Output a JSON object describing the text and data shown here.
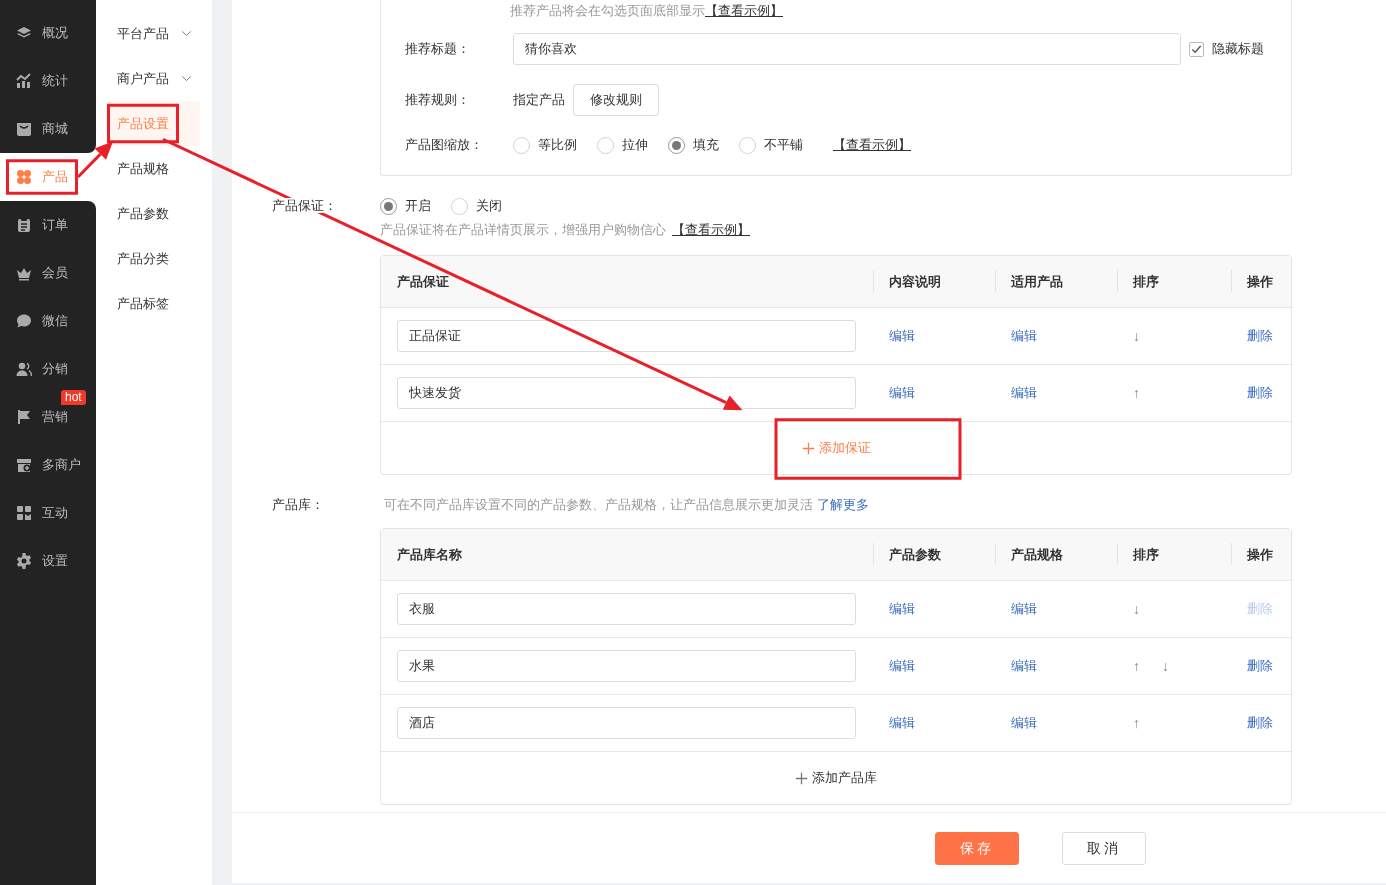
{
  "sidebar": {
    "items": [
      {
        "label": "概况",
        "selected": false,
        "highlighted": false
      },
      {
        "label": "统计",
        "selected": false,
        "highlighted": false
      },
      {
        "label": "商城",
        "selected": false,
        "highlighted": false
      },
      {
        "label": "产品",
        "selected": true,
        "highlighted": true
      },
      {
        "label": "订单",
        "selected": false,
        "highlighted": false
      },
      {
        "label": "会员",
        "selected": false,
        "highlighted": false
      },
      {
        "label": "微信",
        "selected": false,
        "highlighted": false
      },
      {
        "label": "分销",
        "selected": false,
        "highlighted": false
      },
      {
        "label": "营销",
        "selected": false,
        "highlighted": false,
        "badge": "hot"
      },
      {
        "label": "多商户",
        "selected": false,
        "highlighted": false
      },
      {
        "label": "互动",
        "selected": false,
        "highlighted": false
      },
      {
        "label": "设置",
        "selected": false,
        "highlighted": false
      }
    ]
  },
  "submenu": {
    "items": [
      {
        "label": "平台产品",
        "expandable": true,
        "selected": false,
        "highlighted": false
      },
      {
        "label": "商户产品",
        "expandable": true,
        "selected": false,
        "highlighted": false
      },
      {
        "label": "产品设置",
        "expandable": false,
        "selected": true,
        "highlighted": true
      },
      {
        "label": "产品规格",
        "expandable": false,
        "selected": false,
        "highlighted": false
      },
      {
        "label": "产品参数",
        "expandable": false,
        "selected": false,
        "highlighted": false
      },
      {
        "label": "产品分类",
        "expandable": false,
        "selected": false,
        "highlighted": false
      },
      {
        "label": "产品标签",
        "expandable": false,
        "selected": false,
        "highlighted": false
      }
    ]
  },
  "recommend": {
    "hint": "推荐产品将会在勾选页面底部显示",
    "hint_link": "【查看示例】",
    "title_label": "推荐标题：",
    "title_value": "猜你喜欢",
    "hide_title": {
      "label": "隐藏标题",
      "checked": true
    },
    "rule_label": "推荐规则：",
    "rule_value": "指定产品",
    "rule_button": "修改规则",
    "scale_label": "产品图缩放：",
    "scale_options": [
      {
        "label": "等比例",
        "selected": false
      },
      {
        "label": "拉伸",
        "selected": false
      },
      {
        "label": "填充",
        "selected": true
      },
      {
        "label": "不平铺",
        "selected": false
      }
    ],
    "scale_link": "【查看示例】"
  },
  "guarantee": {
    "label": "产品保证：",
    "options": [
      {
        "label": "开启",
        "selected": true
      },
      {
        "label": "关闭",
        "selected": false
      }
    ],
    "hint": "产品保证将在产品详情页展示，增强用户购物信心",
    "hint_link": "【查看示例】",
    "columns": [
      "产品保证",
      "内容说明",
      "适用产品",
      "排序",
      "操作"
    ],
    "rows": [
      {
        "name": "正品保证",
        "col2": "编辑",
        "col3": "编辑",
        "sort": [
          "↓"
        ],
        "action": "删除",
        "disabled": false
      },
      {
        "name": "快速发货",
        "col2": "编辑",
        "col3": "编辑",
        "sort": [
          "↑"
        ],
        "action": "删除",
        "disabled": false
      }
    ],
    "add": {
      "label": "添加保证",
      "accent": true,
      "highlighted": true
    }
  },
  "library": {
    "label": "产品库：",
    "hint": "可在不同产品库设置不同的产品参数、产品规格，让产品信息展示更加灵活",
    "hint_link": "了解更多",
    "columns": [
      "产品库名称",
      "产品参数",
      "产品规格",
      "排序",
      "操作"
    ],
    "rows": [
      {
        "name": "衣服",
        "col2": "编辑",
        "col3": "编辑",
        "sort": [
          "↓"
        ],
        "action": "删除",
        "disabled": true
      },
      {
        "name": "水果",
        "col2": "编辑",
        "col3": "编辑",
        "sort": [
          "↑",
          "↓"
        ],
        "action": "删除",
        "disabled": false
      },
      {
        "name": "酒店",
        "col2": "编辑",
        "col3": "编辑",
        "sort": [
          "↑"
        ],
        "action": "删除",
        "disabled": false
      }
    ],
    "add": {
      "label": "添加产品库",
      "accent": false
    }
  },
  "footer": {
    "buttons": [
      {
        "label": "保存",
        "kind": "primary"
      },
      {
        "label": "取消",
        "kind": "secondary"
      }
    ]
  }
}
